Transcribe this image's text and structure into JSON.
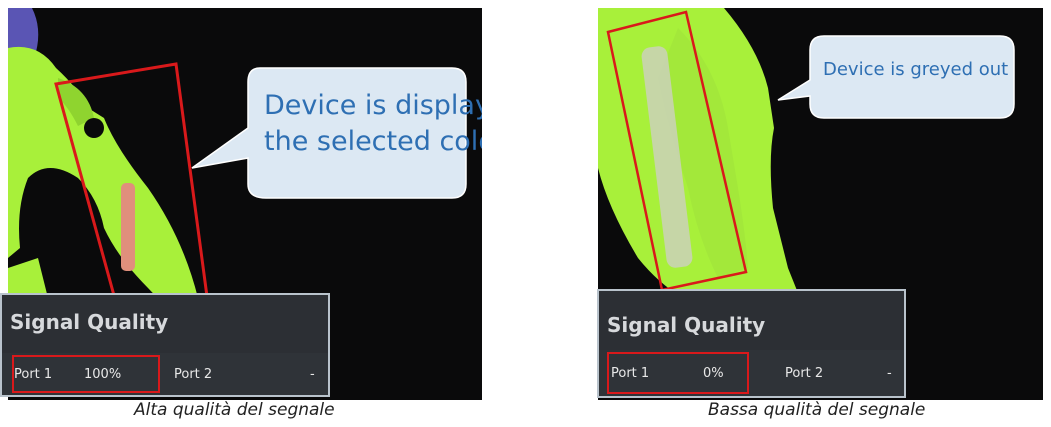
{
  "left_panel": {
    "callout": "Device is displayed in the selected color",
    "signal_quality": {
      "title": "Signal Quality",
      "port1_label": "Port 1",
      "port1_value": "100%",
      "port2_label": "Port 2",
      "port2_value": "-"
    },
    "caption": "Alta qualità del segnale",
    "device_color": "#e08f7c"
  },
  "right_panel": {
    "callout": "Device is greyed out",
    "signal_quality": {
      "title": "Signal Quality",
      "port1_label": "Port 1",
      "port1_value": "0%",
      "port2_label": "Port 2",
      "port2_value": "-"
    },
    "caption": "Bassa qualità del segnale",
    "device_color": "#c9d3b4"
  },
  "colors": {
    "anatomy_green": "#a8f03a",
    "highlight_red": "#d9191b",
    "callout_fill": "#dce8f3",
    "callout_text": "#2e6fb3"
  }
}
